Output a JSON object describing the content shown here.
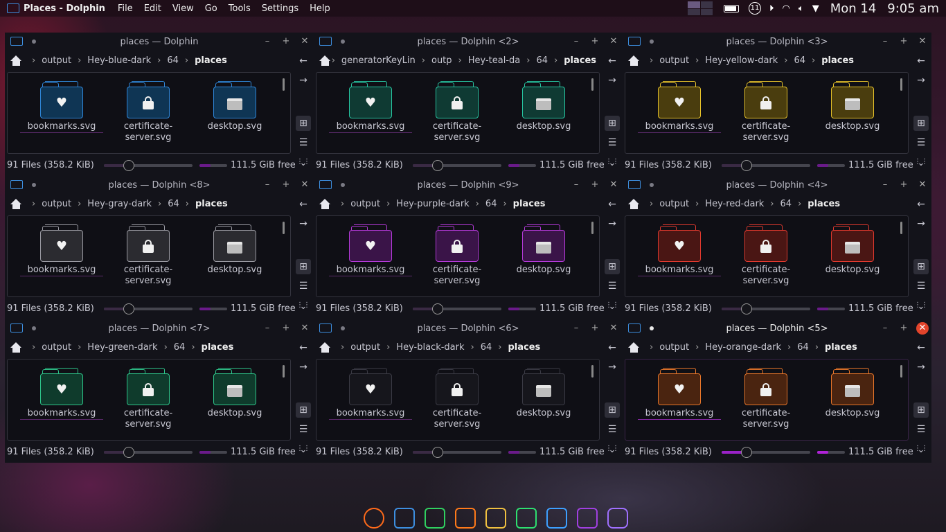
{
  "panel": {
    "app_title": "Places - Dolphin",
    "menu": [
      "File",
      "Edit",
      "View",
      "Go",
      "Tools",
      "Settings",
      "Help"
    ],
    "tray_badge": "11",
    "date": "Mon 14",
    "time": "9:05 am"
  },
  "common": {
    "files_status": "91 Files (358.2 KiB)",
    "free_space": "111.5 GiB free",
    "items": [
      {
        "name": "bookmarks.svg",
        "glyph": "heart"
      },
      {
        "name": "certificate-server.svg",
        "glyph": "lock"
      },
      {
        "name": "desktop.svg",
        "glyph": "desktop"
      }
    ]
  },
  "windows": [
    {
      "title": "places — Dolphin",
      "crumbs": [
        "output",
        "Hey-blue-dark",
        "64",
        "places"
      ],
      "color": "#2f86d8",
      "bg": "#0f3554",
      "active": false
    },
    {
      "title": "places — Dolphin <2>",
      "crumbs": [
        "generatorKeyLin",
        "outp",
        "Hey-teal-da",
        "64",
        "places"
      ],
      "color": "#27c4a0",
      "bg": "#0f3a33",
      "active": false
    },
    {
      "title": "places — Dolphin <3>",
      "crumbs": [
        "output",
        "Hey-yellow-dark",
        "64",
        "places"
      ],
      "color": "#e6c22a",
      "bg": "#4a3d0e",
      "active": false
    },
    {
      "title": "places — Dolphin <8>",
      "crumbs": [
        "output",
        "Hey-gray-dark",
        "64",
        "places"
      ],
      "color": "#9a9aa2",
      "bg": "#2b2b30",
      "active": false
    },
    {
      "title": "places — Dolphin <9>",
      "crumbs": [
        "output",
        "Hey-purple-dark",
        "64",
        "places"
      ],
      "color": "#b43ad8",
      "bg": "#3a1448",
      "active": false
    },
    {
      "title": "places — Dolphin <4>",
      "crumbs": [
        "output",
        "Hey-red-dark",
        "64",
        "places"
      ],
      "color": "#e0392e",
      "bg": "#4a1614",
      "active": false
    },
    {
      "title": "places — Dolphin <7>",
      "crumbs": [
        "output",
        "Hey-green-dark",
        "64",
        "places"
      ],
      "color": "#2ec58a",
      "bg": "#0f3b2c",
      "active": false
    },
    {
      "title": "places — Dolphin <6>",
      "crumbs": [
        "output",
        "Hey-black-dark",
        "64",
        "places"
      ],
      "color": "#3a3a44",
      "bg": "#16161c",
      "active": false
    },
    {
      "title": "places — Dolphin <5>",
      "crumbs": [
        "output",
        "Hey-orange-dark",
        "64",
        "places"
      ],
      "color": "#e8762a",
      "bg": "#4a2410",
      "active": true
    }
  ],
  "dock": [
    {
      "icon": "firefox-icon",
      "color": "#ff6a1a"
    },
    {
      "icon": "folder-icon",
      "color": "#3d8fe0"
    },
    {
      "icon": "settings-gear-icon",
      "color": "#30d060"
    },
    {
      "icon": "vlc-cone-icon",
      "color": "#ff7a1a"
    },
    {
      "icon": "speaker-icon",
      "color": "#f0c040"
    },
    {
      "icon": "chip-icon",
      "color": "#2ee070"
    },
    {
      "icon": "vscode-icon",
      "color": "#3da0ff"
    },
    {
      "icon": "terminal-icon",
      "color": "#a040e0"
    },
    {
      "icon": "camera-icon",
      "color": "#a070ff"
    }
  ]
}
